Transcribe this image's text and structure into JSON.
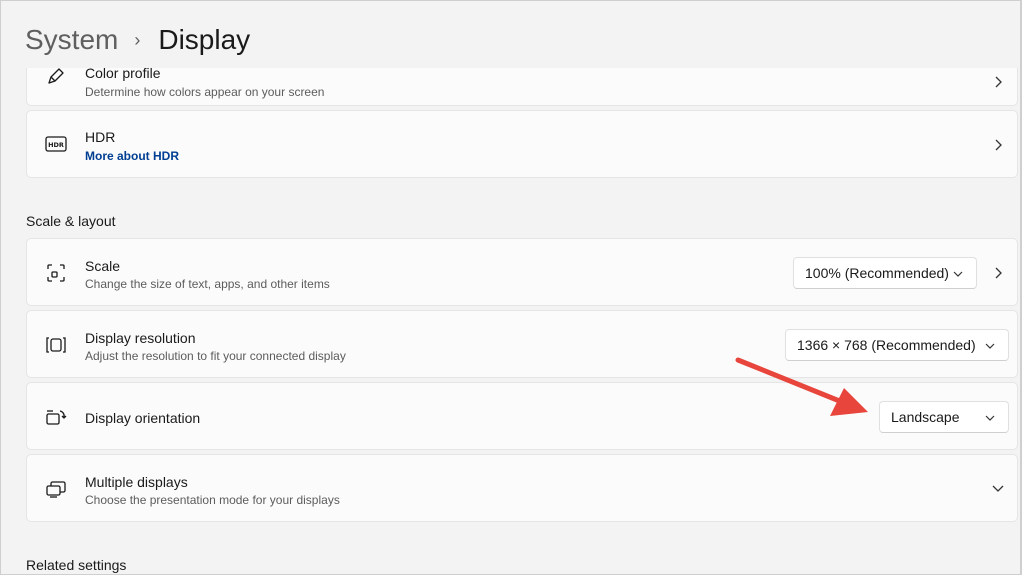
{
  "breadcrumb": {
    "parent": "System",
    "separator": "›",
    "current": "Display"
  },
  "color_profile": {
    "title": "Color profile",
    "description": "Determine how colors appear on your screen"
  },
  "hdr": {
    "title": "HDR",
    "link": "More about HDR"
  },
  "scale_layout": {
    "heading": "Scale & layout",
    "scale": {
      "title": "Scale",
      "description": "Change the size of text, apps, and other items",
      "value": "100% (Recommended)"
    },
    "resolution": {
      "title": "Display resolution",
      "description": "Adjust the resolution to fit your connected display",
      "value": "1366 × 768 (Recommended)"
    },
    "orientation": {
      "title": "Display orientation",
      "value": "Landscape"
    },
    "multiple": {
      "title": "Multiple displays",
      "description": "Choose the presentation mode for your displays"
    }
  },
  "related": {
    "heading": "Related settings"
  },
  "colors": {
    "accent_link": "#003e92",
    "annotation_arrow": "#e8453c"
  }
}
